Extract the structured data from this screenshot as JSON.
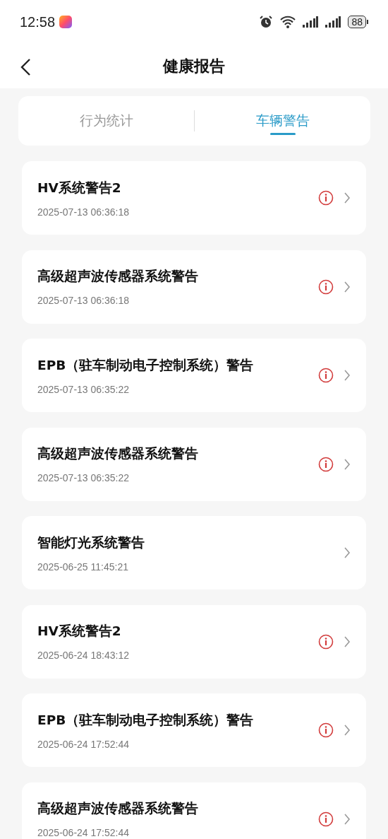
{
  "status_bar": {
    "time": "12:58",
    "battery": "88"
  },
  "header": {
    "title": "健康报告"
  },
  "tabs": [
    {
      "label": "行为统计",
      "selected": false
    },
    {
      "label": "车辆警告",
      "selected": true
    }
  ],
  "alerts": [
    {
      "title": "HV系统警告2",
      "time": "2025-07-13 06:36:18",
      "warning": true
    },
    {
      "title": "高级超声波传感器系统警告",
      "time": "2025-07-13 06:36:18",
      "warning": true
    },
    {
      "title": "EPB（驻车制动电子控制系统）警告",
      "time": "2025-07-13 06:35:22",
      "warning": true
    },
    {
      "title": "高级超声波传感器系统警告",
      "time": "2025-07-13 06:35:22",
      "warning": true
    },
    {
      "title": "智能灯光系统警告",
      "time": "2025-06-25 11:45:21",
      "warning": false
    },
    {
      "title": "HV系统警告2",
      "time": "2025-06-24 18:43:12",
      "warning": true
    },
    {
      "title": "EPB（驻车制动电子控制系统）警告",
      "time": "2025-06-24 17:52:44",
      "warning": true
    },
    {
      "title": "高级超声波传感器系统警告",
      "time": "2025-06-24 17:52:44",
      "warning": true
    }
  ]
}
